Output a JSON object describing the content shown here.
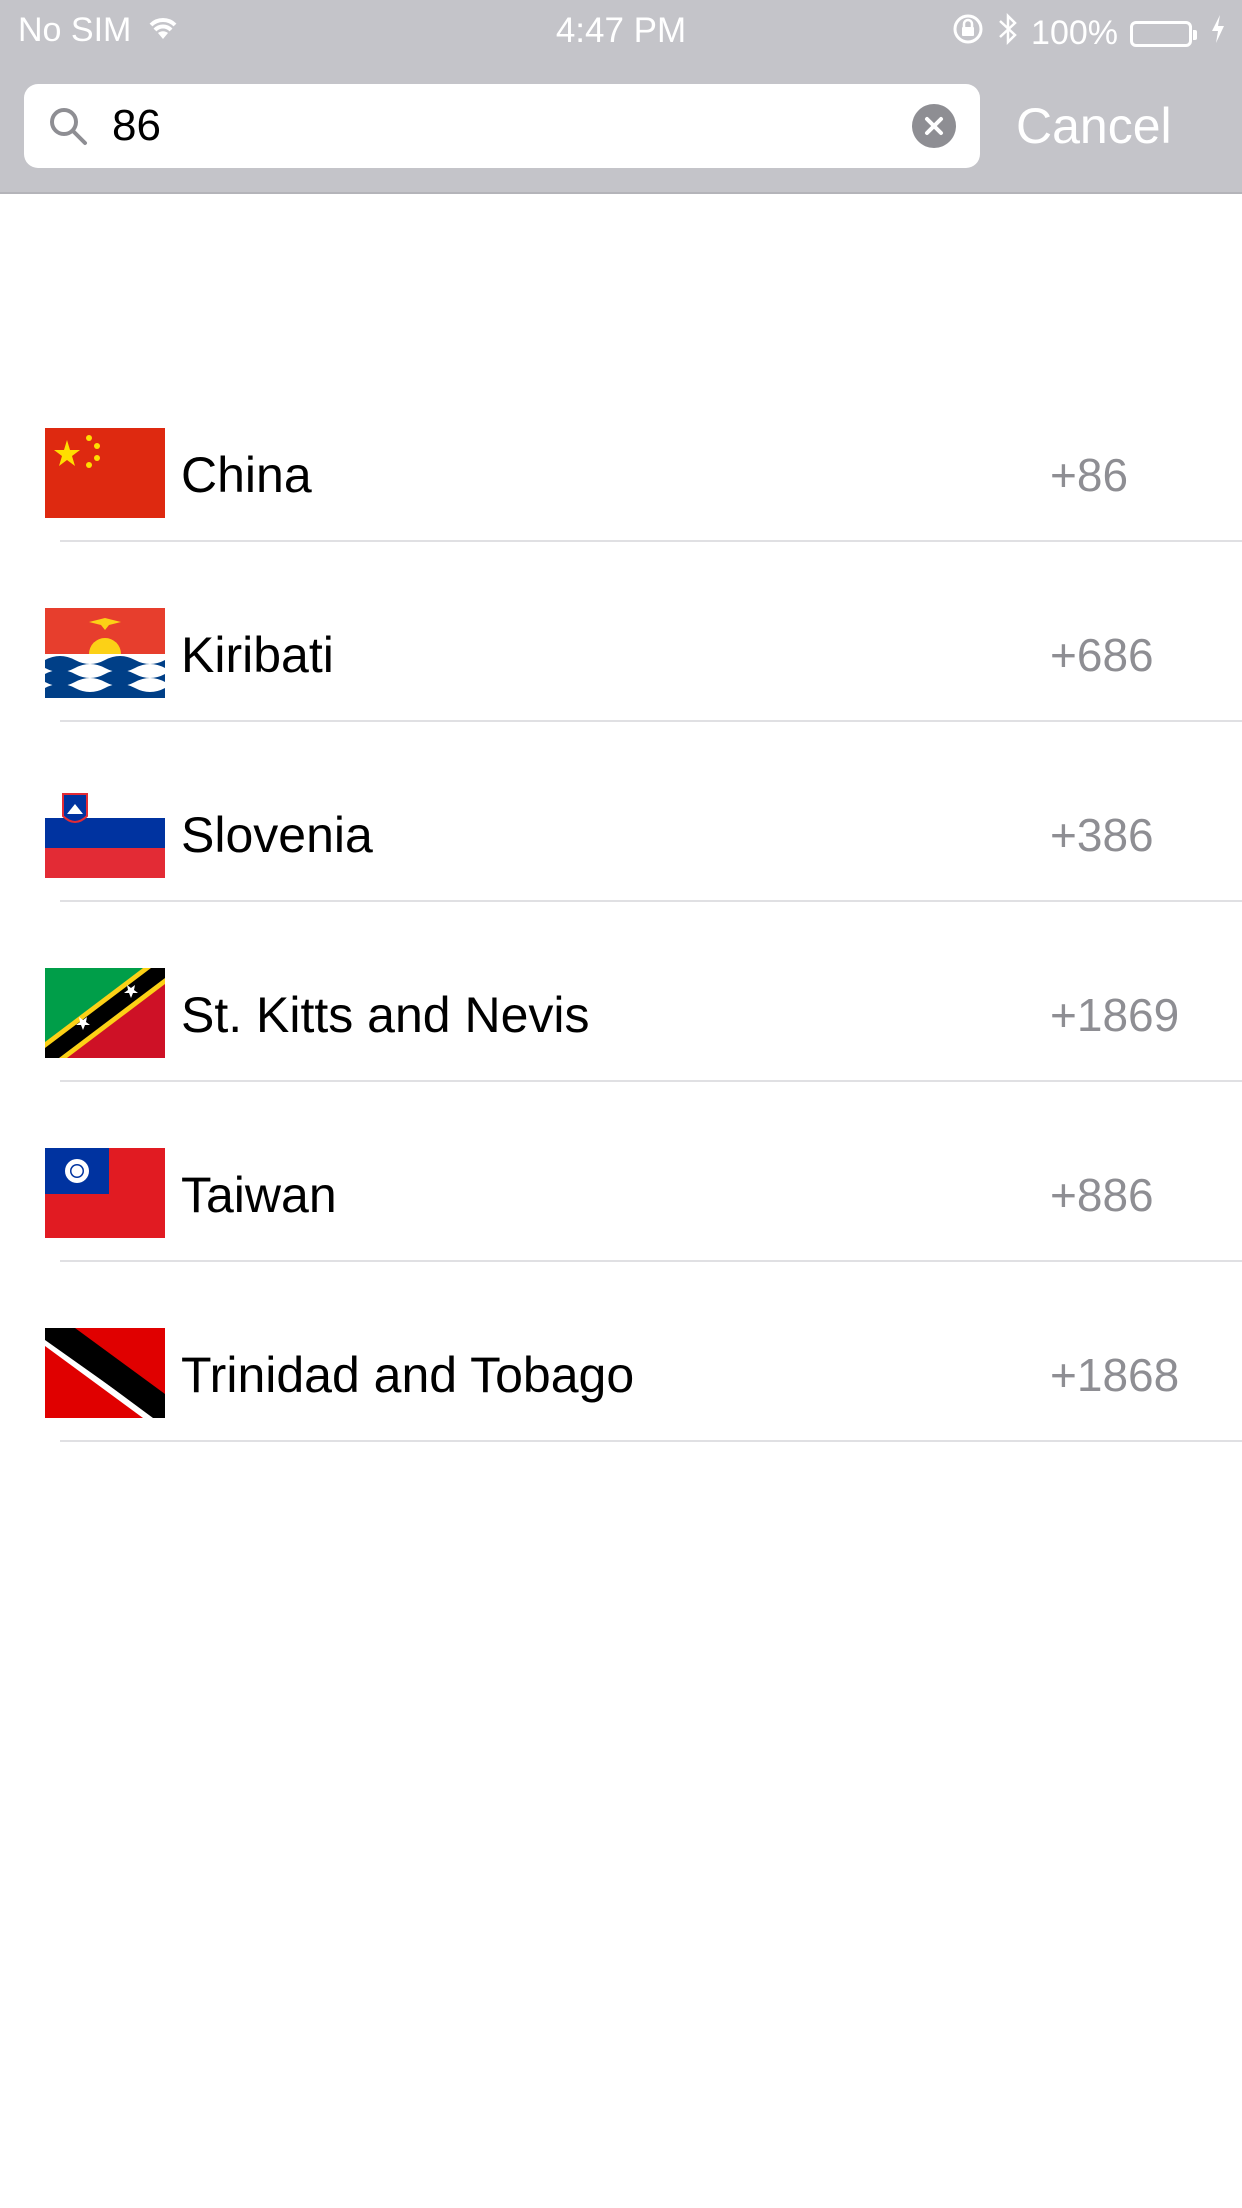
{
  "status_bar": {
    "carrier": "No SIM",
    "time": "4:47 PM",
    "battery": "100%",
    "icons": [
      "wifi-icon",
      "rotation-lock-icon",
      "bluetooth-icon",
      "battery-icon",
      "charging-bolt-icon"
    ]
  },
  "search": {
    "value": "86",
    "cancel_label": "Cancel",
    "icons": [
      "search-icon",
      "clear-icon"
    ]
  },
  "countries": [
    {
      "name": "China",
      "code": "+86",
      "flag": "china-flag-icon"
    },
    {
      "name": "Kiribati",
      "code": "+686",
      "flag": "kiribati-flag-icon"
    },
    {
      "name": "Slovenia",
      "code": "+386",
      "flag": "slovenia-flag-icon"
    },
    {
      "name": "St. Kitts and Nevis",
      "code": "+1869",
      "flag": "st-kitts-and-nevis-flag-icon"
    },
    {
      "name": "Taiwan",
      "code": "+886",
      "flag": "taiwan-flag-icon"
    },
    {
      "name": "Trinidad and Tobago",
      "code": "+1868",
      "flag": "trinidad-and-tobago-flag-icon"
    }
  ],
  "colors": {
    "search_bar_bg": "#c4c4c9",
    "battery_fill": "#4cd964",
    "secondary_text": "#8e8e93"
  }
}
